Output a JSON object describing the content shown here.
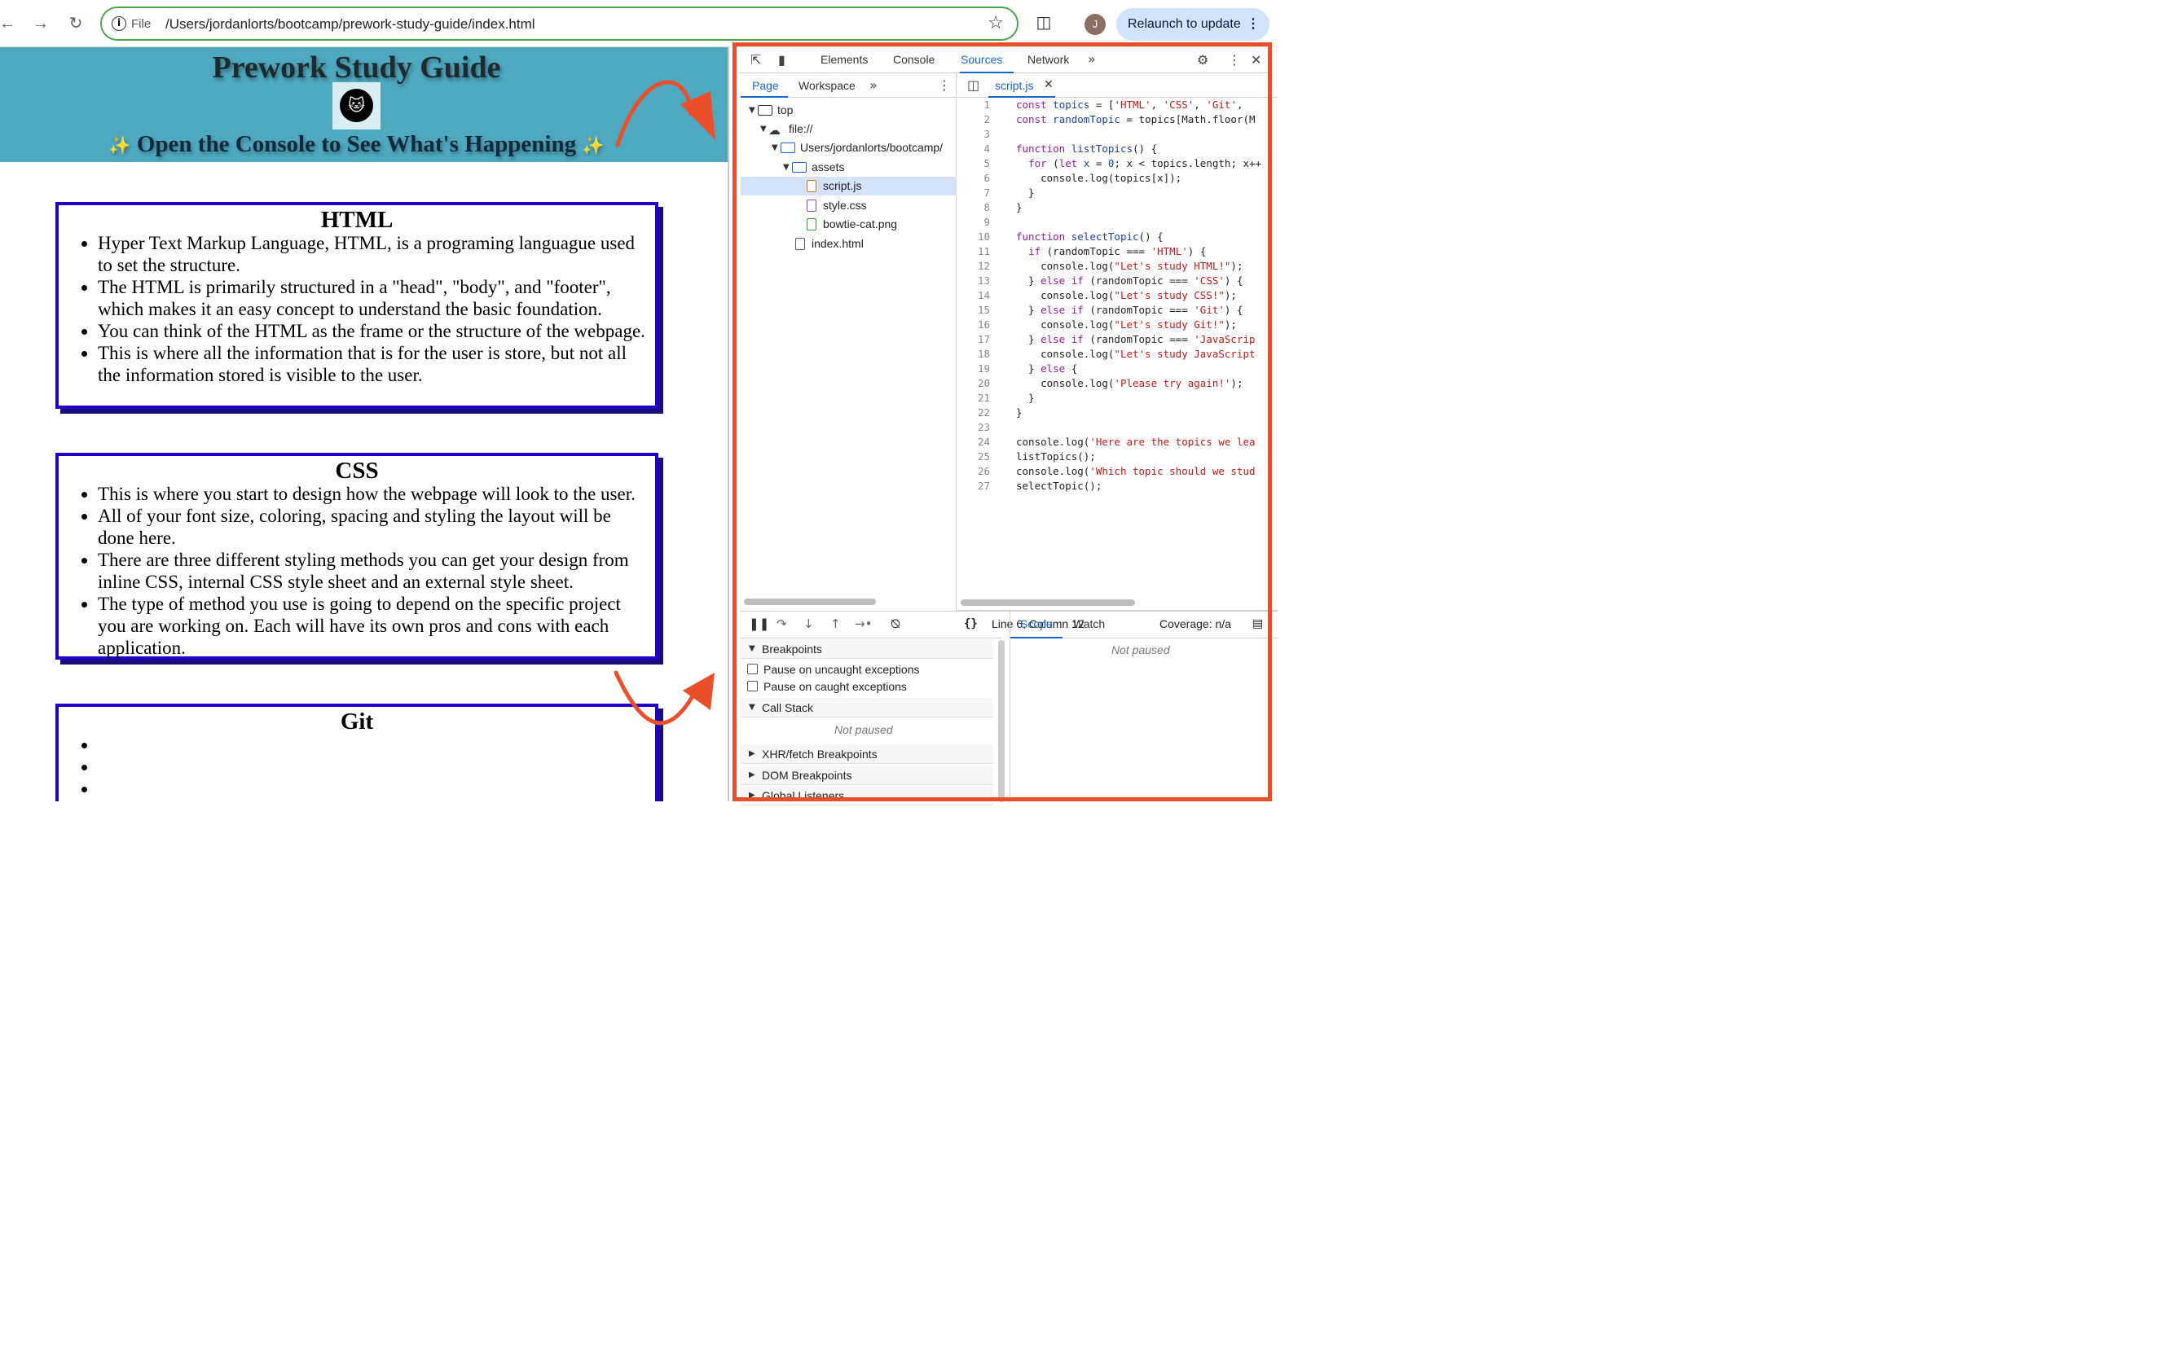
{
  "browser": {
    "omnibox_scheme": "File",
    "url": "/Users/jordanlorts/bootcamp/prework-study-guide/index.html",
    "profile_initial": "J",
    "relaunch_label": "Relaunch to update",
    "icons": [
      "back-icon",
      "forward-icon",
      "reload-icon",
      "info-icon",
      "star-icon",
      "extensions-icon",
      "more-icon"
    ]
  },
  "page": {
    "title": "Prework Study Guide",
    "subtitle": "Open the Console to See What's Happening",
    "sparkle": "✨",
    "colors": {
      "hero": "#4ea8c0",
      "card_border": "#2200cc"
    },
    "sections": [
      {
        "heading": "HTML",
        "items": [
          "Hyper Text Markup Language, HTML, is a programing languague used to set the structure.",
          "The HTML is primarily structured in a \"head\", \"body\", and \"footer\", which makes it an easy concept to understand the basic foundation.",
          "You can think of the HTML as the frame or the structure of the webpage.",
          "This is where all the information that is for the user is store, but not all the information stored is visible to the user."
        ]
      },
      {
        "heading": "CSS",
        "items": [
          "This is where you start to design how the webpage will look to the user.",
          "All of your font size, coloring, spacing and styling the layout will be done here.",
          "There are three different styling methods you can get your design from inline CSS, internal CSS style sheet and an external style sheet.",
          "The type of method you use is going to depend on the specific project you are working on. Each will have its own pros and cons with each application."
        ]
      },
      {
        "heading": "Git",
        "items": [
          "",
          "",
          ""
        ]
      }
    ]
  },
  "devtools": {
    "tabs": [
      "Elements",
      "Console",
      "Sources",
      "Network"
    ],
    "active_tab": "Sources",
    "navigator_tabs": [
      "Page",
      "Workspace"
    ],
    "tree": {
      "top": "top",
      "origin": "file://",
      "folder": "Users/jordanlorts/bootcamp/",
      "assets": "assets",
      "files": [
        "script.js",
        "style.css",
        "bowtie-cat.png"
      ],
      "index": "index.html"
    },
    "editor_tab": "script.js",
    "code_lines": [
      "1",
      "2",
      "3",
      "4",
      "5",
      "6",
      "7",
      "8",
      "9",
      "10",
      "11",
      "12",
      "13",
      "14",
      "15",
      "16",
      "17",
      "18",
      "19",
      "20",
      "21",
      "22",
      "23",
      "24",
      "25",
      "26",
      "27"
    ],
    "cursor_status": "Line 6, Column 12",
    "coverage": "Coverage: n/a",
    "sections": {
      "breakpoints": "Breakpoints",
      "pause_uncaught": "Pause on uncaught exceptions",
      "pause_caught": "Pause on caught exceptions",
      "call_stack": "Call Stack",
      "not_paused": "Not paused",
      "xhr": "XHR/fetch Breakpoints",
      "dom": "DOM Breakpoints",
      "global": "Global Listeners"
    },
    "scope_tabs": [
      "Scope",
      "Watch"
    ],
    "scope_not_paused": "Not paused",
    "accent": "#1a63d8",
    "highlight_border": "#ea4f2b"
  }
}
